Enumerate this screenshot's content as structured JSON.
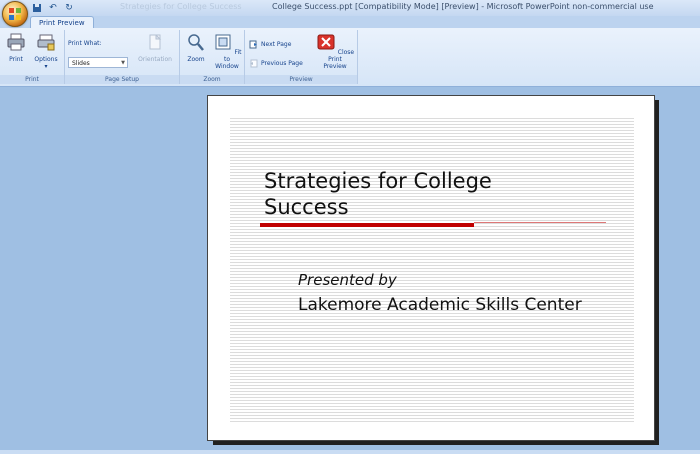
{
  "window": {
    "title": "College Success.ppt [Compatibility Mode] [Preview] - Microsoft PowerPoint non-commercial use",
    "ghost_text": "Strategies for College Success"
  },
  "tabs": [
    {
      "label": "Print Preview",
      "active": true
    }
  ],
  "ribbon": {
    "groups": {
      "print": {
        "label": "Print",
        "print_button": "Print",
        "options_button": "Options"
      },
      "page_setup": {
        "label": "Page Setup",
        "print_what_label": "Print What:",
        "print_what_value": "Slides",
        "orientation_button": "Orientation"
      },
      "zoom": {
        "label": "Zoom",
        "zoom_button": "Zoom",
        "fit_line1": "Fit to",
        "fit_line2": "Window"
      },
      "preview": {
        "label": "Preview",
        "next_page": "Next Page",
        "previous_page": "Previous Page",
        "close_line1": "Close Print",
        "close_line2": "Preview"
      }
    }
  },
  "slide": {
    "title_line1": "Strategies for College",
    "title_line2": "Success",
    "presented_by": "Presented by",
    "organization": "Lakemore Academic Skills Center"
  },
  "colors": {
    "accent_red": "#c00000",
    "ribbon_blue": "#15428b",
    "workspace": "#9fbfe3"
  }
}
